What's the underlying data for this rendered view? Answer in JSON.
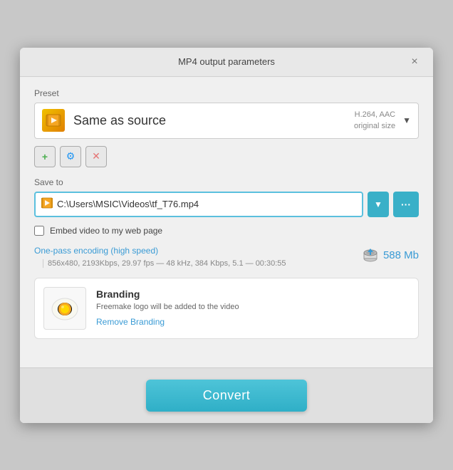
{
  "dialog": {
    "title": "MP4 output parameters",
    "close_label": "×"
  },
  "preset": {
    "label": "Preset",
    "icon": "🎬",
    "name": "Same as source",
    "codec": "H.264, AAC",
    "size_info": "original size"
  },
  "action_buttons": {
    "add_label": "+",
    "settings_label": "⚙",
    "remove_label": "✕"
  },
  "save_to": {
    "label": "Save to",
    "file_icon": "🎬",
    "path": "C:\\Users\\MSIC\\Videos\\tf_T76.mp4",
    "dropdown_icon": "▼",
    "browse_icon": "···"
  },
  "embed": {
    "label": "Embed video to my web page",
    "checked": false
  },
  "encoding": {
    "link_text": "One-pass encoding (high speed)",
    "details": "856x480, 2193Kbps, 29.97 fps — 48 kHz, 384 Kbps, 5.1 — 00:30:55",
    "size": "588 Mb"
  },
  "branding": {
    "title": "Branding",
    "description": "Freemake logo will be added to the video",
    "remove_link": "Remove Branding"
  },
  "footer": {
    "convert_label": "Convert"
  }
}
